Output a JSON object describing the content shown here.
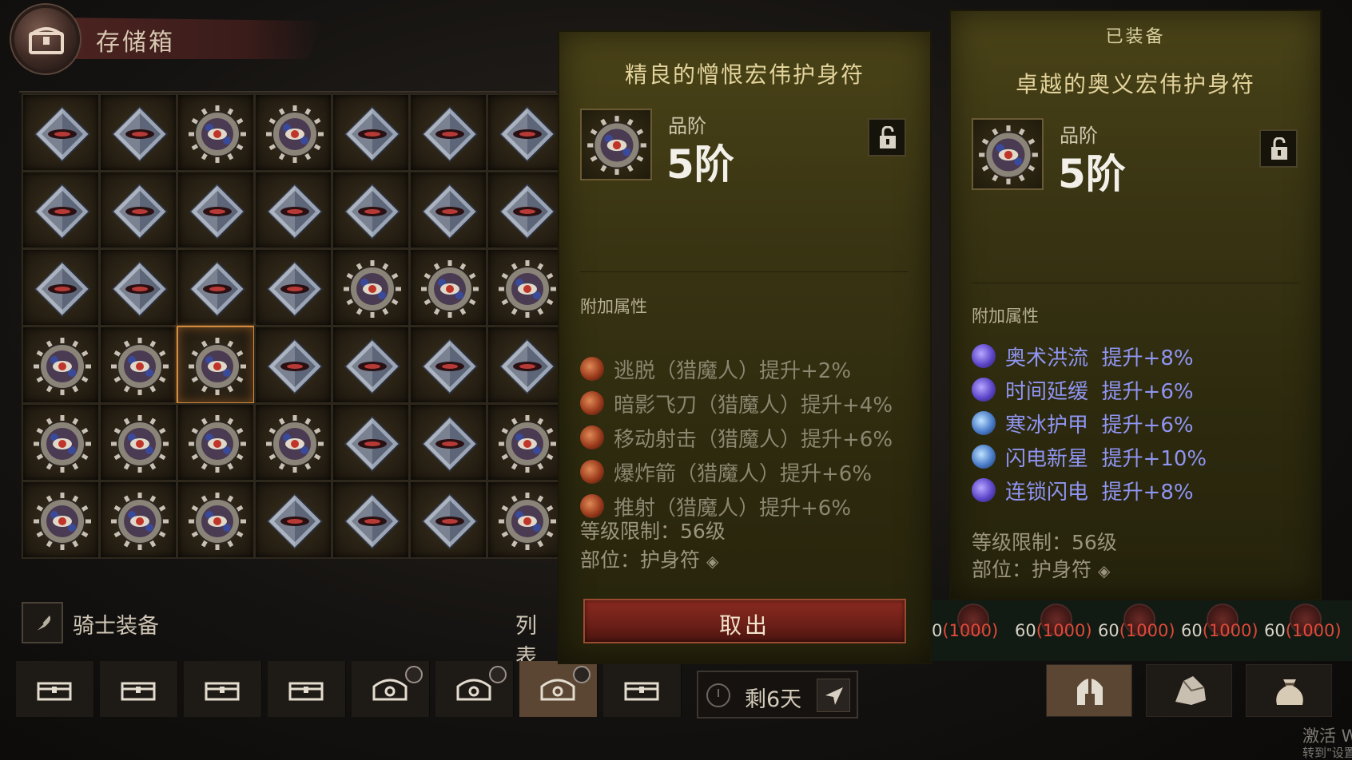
{
  "header": {
    "title": "存储箱"
  },
  "stash": {
    "cells": [
      "diamond",
      "diamond",
      "orb",
      "orb",
      "diamond",
      "diamond",
      "diamond",
      "diamond",
      "diamond",
      "diamond",
      "diamond",
      "diamond",
      "diamond",
      "diamond",
      "diamond",
      "diamond",
      "diamond",
      "diamond",
      "orb",
      "orb",
      "orb",
      "orb",
      "orb",
      "orb",
      "diamond",
      "diamond",
      "diamond",
      "diamond",
      "orb",
      "orb",
      "orb",
      "orb",
      "diamond",
      "diamond",
      "orb",
      "orb",
      "orb",
      "orb",
      "diamond",
      "diamond",
      "diamond",
      "orb"
    ],
    "selected_index": 23,
    "section_label": "骑士装备",
    "list_label": "列表"
  },
  "tabs": {
    "active_index": 6,
    "items": [
      {
        "icon": "chest-icon",
        "has_timer": false
      },
      {
        "icon": "chest-icon",
        "has_timer": false
      },
      {
        "icon": "chest-icon",
        "has_timer": false
      },
      {
        "icon": "chest-icon",
        "has_timer": false
      },
      {
        "icon": "ornate-chest-icon",
        "has_timer": true
      },
      {
        "icon": "ornate-chest-icon",
        "has_timer": true
      },
      {
        "icon": "ornate-chest-icon",
        "has_timer": true
      },
      {
        "icon": "chest-icon",
        "has_timer": false
      }
    ],
    "timer_text": "剩6天",
    "right_tabs": [
      "helmet-icon",
      "ore-icon",
      "pouch-icon"
    ]
  },
  "tooltip_left": {
    "title": "精良的憎恨宏伟护身符",
    "quality_label": "品阶",
    "quality_value": "5阶",
    "attr_heading": "附加属性",
    "affixes": [
      {
        "text": "逃脱（猎魔人）提升+2%",
        "icon": "red"
      },
      {
        "text": "暗影飞刀（猎魔人）提升+4%",
        "icon": "red"
      },
      {
        "text": "移动射击（猎魔人）提升+6%",
        "icon": "red"
      },
      {
        "text": "爆炸箭（猎魔人）提升+6%",
        "icon": "red"
      },
      {
        "text": "推射（猎魔人）提升+6%",
        "icon": "red"
      }
    ],
    "level_req": "等级限制：56级",
    "slot": "部位：护身符",
    "take_button": "取出"
  },
  "tooltip_right": {
    "equipped_label": "已装备",
    "title": "卓越的奥义宏伟护身符",
    "quality_label": "品阶",
    "quality_value": "5阶",
    "attr_heading": "附加属性",
    "affixes": [
      {
        "name": "奥术洪流",
        "bonus": "提升+8%",
        "icon": "purple"
      },
      {
        "name": "时间延缓",
        "bonus": "提升+6%",
        "icon": "purple"
      },
      {
        "name": "寒冰护甲",
        "bonus": "提升+6%",
        "icon": "ice"
      },
      {
        "name": "闪电新星",
        "bonus": "提升+10%",
        "icon": "ice"
      },
      {
        "name": "连锁闪电",
        "bonus": "提升+8%",
        "icon": "purple"
      }
    ],
    "level_req": "等级限制：56级",
    "slot": "部位：护身符"
  },
  "ranks": [
    {
      "level": "0",
      "score": "(1000)"
    },
    {
      "level": "60",
      "score": "(1000)"
    },
    {
      "level": "60",
      "score": "(1000)"
    },
    {
      "level": "60",
      "score": "(1000)"
    },
    {
      "level": "60",
      "score": "(1000)"
    }
  ],
  "watermark": {
    "line1": "激活 W",
    "line2": "转到\"设置"
  }
}
